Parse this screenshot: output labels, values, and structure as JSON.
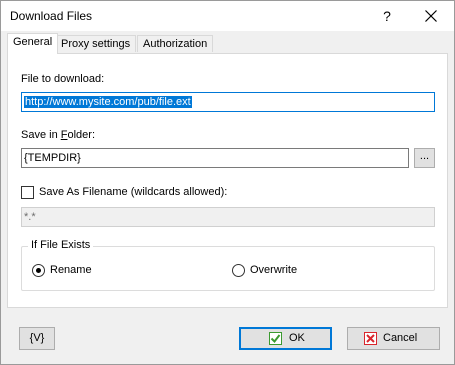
{
  "window": {
    "title": "Download Files",
    "help_label": "?"
  },
  "tabs": [
    {
      "label": "General",
      "active": true
    },
    {
      "label": "Proxy settings",
      "active": false
    },
    {
      "label": "Authorization",
      "active": false
    }
  ],
  "form": {
    "file_label": "File to download:",
    "file_value": "http://www.mysite.com/pub/file.ext",
    "folder_label_pre": "Save in ",
    "folder_label_accel": "F",
    "folder_label_post": "older:",
    "folder_value": "{TEMPDIR}",
    "browse_label": "...",
    "save_as_label": "Save As Filename (wildcards allowed):",
    "save_as_checked": false,
    "save_as_value": "*.*"
  },
  "if_exists": {
    "title": "If File Exists",
    "options": [
      {
        "label": "Rename",
        "selected": true
      },
      {
        "label": "Overwrite",
        "selected": false
      }
    ]
  },
  "buttons": {
    "variables_label": "{V}",
    "ok_label": "OK",
    "cancel_label": "Cancel"
  },
  "colors": {
    "accent": "#0078d7",
    "ok_icon": "#3a9a2f",
    "cancel_icon": "#d9262c"
  }
}
